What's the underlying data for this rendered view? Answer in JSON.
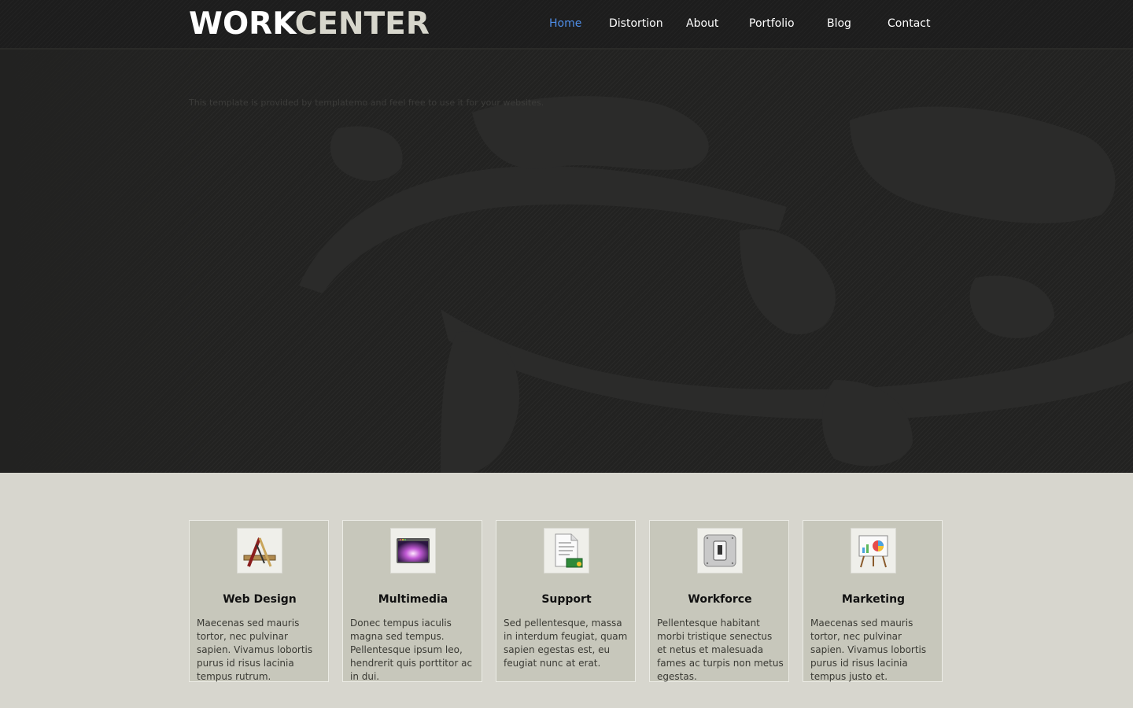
{
  "header": {
    "logo_part1": "WORK",
    "logo_part2": "CENTER",
    "nav": [
      "Home",
      "Distortion",
      "About",
      "Portfolio",
      "Blog",
      "Contact"
    ],
    "active_nav": "Home"
  },
  "hero": {
    "note": "This template is provided by templatemo and feel free to use it for your websites."
  },
  "services": [
    {
      "title": "Web Design",
      "icon": "pencil-ruler-icon",
      "text": "Maecenas sed mauris tortor, nec pulvinar sapien. Vivamus lobortis purus id risus lacinia tempus rutrum."
    },
    {
      "title": "Multimedia",
      "icon": "media-player-icon",
      "text": "Donec tempus iaculis magna sed tempus. Pellentesque ipsum leo, hendrerit quis porttitor ac in dui."
    },
    {
      "title": "Support",
      "icon": "document-icon",
      "text": "Sed pellentesque, massa in interdum feugiat, quam sapien egestas est, eu feugiat nunc at erat."
    },
    {
      "title": "Workforce",
      "icon": "switch-icon",
      "text": "Pellentesque habitant morbi tristique senectus et netus et malesuada fames ac turpis non metus egestas."
    },
    {
      "title": "Marketing",
      "icon": "presentation-easel-icon",
      "text": "Maecenas sed mauris tortor, nec pulvinar sapien. Vivamus lobortis purus id risus lacinia tempus justo et."
    }
  ],
  "colors": {
    "header_bg": "#1d1d1d",
    "hero_bg": "#222221",
    "page_bg": "#d7d6ce",
    "card_bg": "#c7c7bb",
    "nav_active": "#4f8ee8"
  }
}
